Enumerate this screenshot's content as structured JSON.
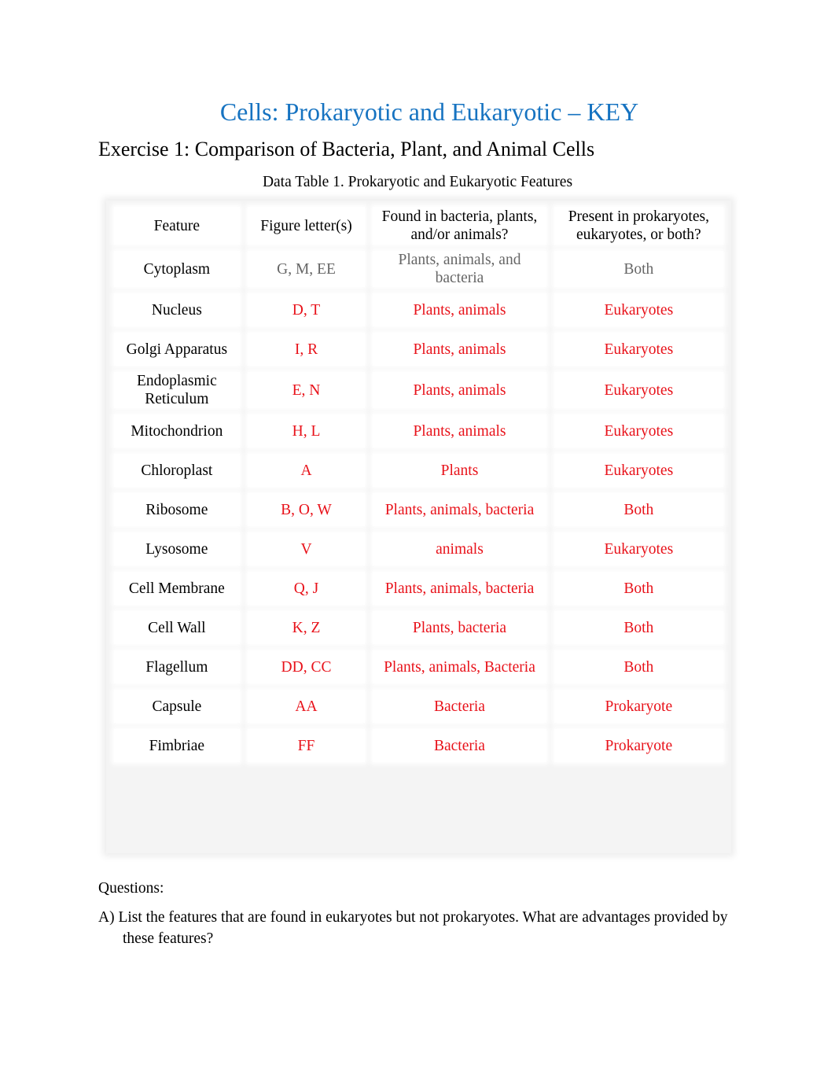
{
  "document": {
    "title": "Cells: Prokaryotic and Eukaryotic – KEY",
    "exercise_heading": "Exercise 1: Comparison of Bacteria, Plant, and Animal Cells",
    "table_caption": "Data Table 1.  Prokaryotic and Eukaryotic Features",
    "colors": {
      "title": "#1673c1",
      "answer": "#e8121a",
      "example": "#666666"
    }
  },
  "table": {
    "headers": [
      "Feature",
      "Figure letter(s)",
      "Found in bacteria, plants, and/or animals?",
      "Present in prokaryotes, eukaryotes, or both?"
    ],
    "rows": [
      {
        "feature": "Cytoplasm",
        "letters": "G, M, EE",
        "found_in": "Plants, animals, and bacteria",
        "present_in": "Both",
        "style": "gray"
      },
      {
        "feature": "Nucleus",
        "letters": "D, T",
        "found_in": "Plants, animals",
        "present_in": "Eukaryotes",
        "style": "red"
      },
      {
        "feature": "Golgi Apparatus",
        "letters": "I, R",
        "found_in": "Plants, animals",
        "present_in": "Eukaryotes",
        "style": "red"
      },
      {
        "feature": "Endoplasmic Reticulum",
        "letters": "E, N",
        "found_in": "Plants, animals",
        "present_in": "Eukaryotes",
        "style": "red"
      },
      {
        "feature": "Mitochondrion",
        "letters": "H, L",
        "found_in": "Plants, animals",
        "present_in": "Eukaryotes",
        "style": "red"
      },
      {
        "feature": "Chloroplast",
        "letters": "A",
        "found_in": "Plants",
        "present_in": "Eukaryotes",
        "style": "red"
      },
      {
        "feature": "Ribosome",
        "letters": "B, O, W",
        "found_in": "Plants, animals, bacteria",
        "present_in": "Both",
        "style": "red"
      },
      {
        "feature": "Lysosome",
        "letters": "V",
        "found_in": "animals",
        "present_in": "Eukaryotes",
        "style": "red"
      },
      {
        "feature": "Cell Membrane",
        "letters": "Q, J",
        "found_in": "Plants, animals, bacteria",
        "present_in": "Both",
        "style": "red"
      },
      {
        "feature": "Cell Wall",
        "letters": "K, Z",
        "found_in": "Plants, bacteria",
        "present_in": "Both",
        "style": "red"
      },
      {
        "feature": "Flagellum",
        "letters": "DD, CC",
        "found_in": "Plants, animals, Bacteria",
        "present_in": "Both",
        "style": "red"
      },
      {
        "feature": "Capsule",
        "letters": "AA",
        "found_in": "Bacteria",
        "present_in": "Prokaryote",
        "style": "red"
      },
      {
        "feature": "Fimbriae",
        "letters": "FF",
        "found_in": "Bacteria",
        "present_in": "Prokaryote",
        "style": "red"
      }
    ]
  },
  "questions": {
    "heading": "Questions:",
    "items": [
      {
        "label": "A)",
        "text": "List the features that are found in eukaryotes but not prokaryotes. What are advantages provided by these features?"
      }
    ]
  }
}
